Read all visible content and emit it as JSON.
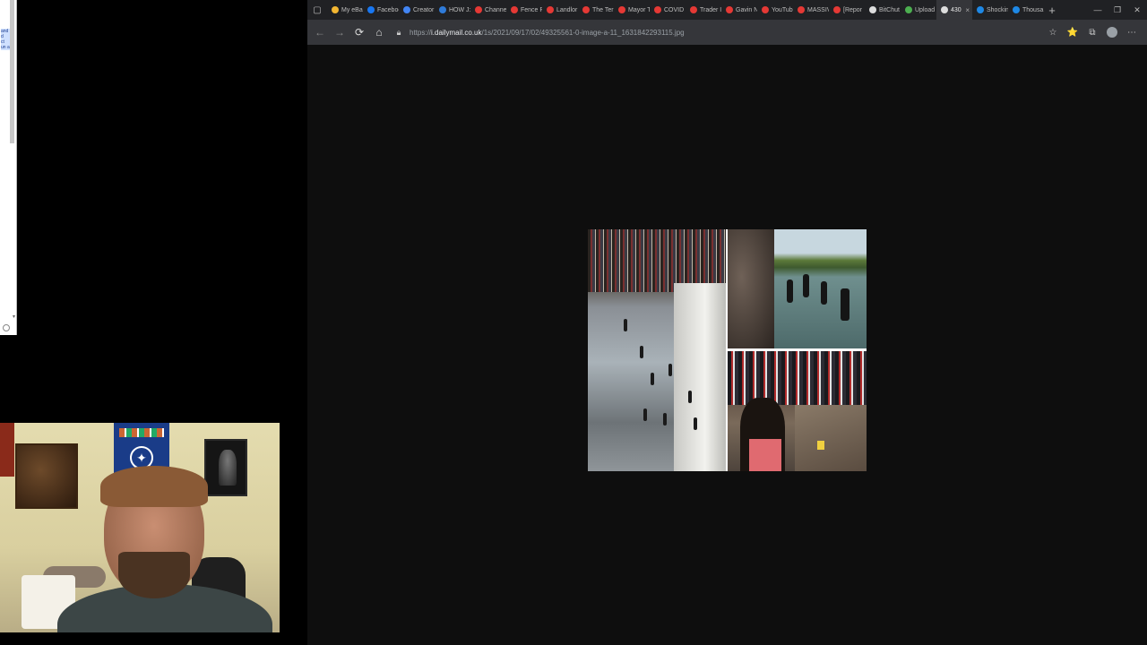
{
  "desktop": {
    "doc_strip_text": [
      "and",
      "d",
      "ct",
      "un a"
    ]
  },
  "browser": {
    "tabs": [
      {
        "label": "My eBa",
        "color": "#f2b632"
      },
      {
        "label": "Faceboo",
        "color": "#1877f2"
      },
      {
        "label": "Creator",
        "color": "#4285f4"
      },
      {
        "label": "HOW J:",
        "color": "#2f7bd9"
      },
      {
        "label": "Channe",
        "color": "#e53935"
      },
      {
        "label": "Fence P",
        "color": "#e53935"
      },
      {
        "label": "Landlor",
        "color": "#e53935"
      },
      {
        "label": "The Ter",
        "color": "#e53935"
      },
      {
        "label": "Mayor T",
        "color": "#e53935"
      },
      {
        "label": "COVID",
        "color": "#e53935"
      },
      {
        "label": "Trader I",
        "color": "#e53935"
      },
      {
        "label": "Gavin N",
        "color": "#e53935"
      },
      {
        "label": "YouTube",
        "color": "#e53935"
      },
      {
        "label": "MASSIV",
        "color": "#e53935"
      },
      {
        "label": "[Repor",
        "color": "#e53935"
      },
      {
        "label": "BitChut",
        "color": "#dddddd"
      },
      {
        "label": "Upload",
        "color": "#4caf50"
      },
      {
        "label": "430",
        "color": "#dddddd",
        "active": true
      },
      {
        "label": "Shockin",
        "color": "#1e88e5"
      },
      {
        "label": "Thousa",
        "color": "#1e88e5"
      }
    ],
    "new_tab_label": "+",
    "window_controls": [
      "—",
      "❐",
      "✕"
    ],
    "url": {
      "prefix": "https://",
      "host": "i.dailymail.co.uk",
      "path": "/1s/2021/09/17/02/49325561-0-image-a-11_1631842293115.jpg"
    },
    "nav": {
      "back": "←",
      "forward": "→",
      "reload": "⟳",
      "home": "⌂"
    },
    "toolbar_icons": [
      "☆",
      "⭐",
      "⧉",
      "⋯"
    ]
  },
  "image": {
    "panels": [
      "river-crossing-crowd",
      "people-wading-river",
      "crowd-on-riverbank"
    ]
  }
}
